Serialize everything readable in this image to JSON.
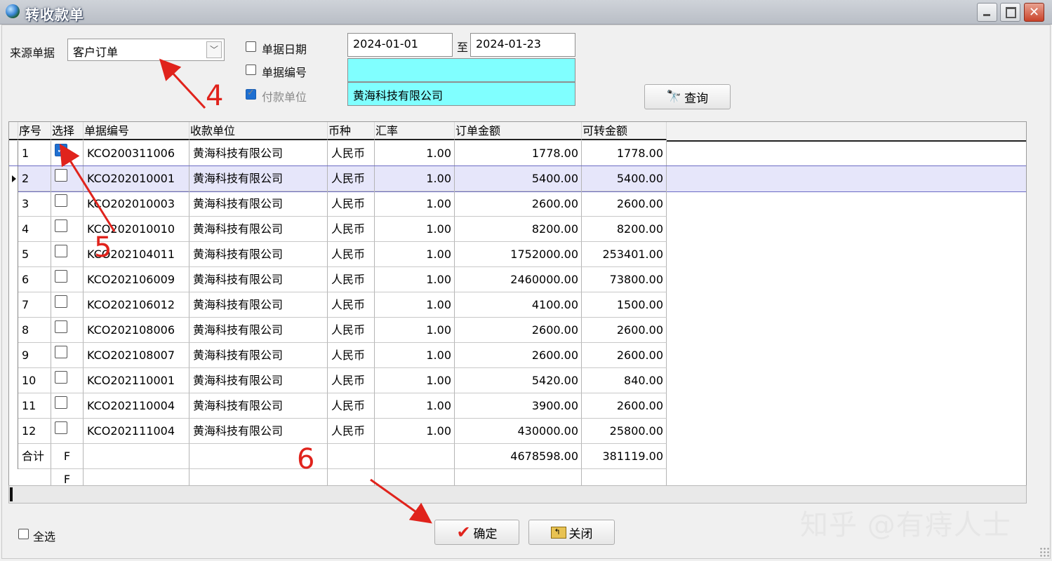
{
  "window": {
    "title": "转收款单"
  },
  "filters": {
    "source_label": "来源单据",
    "source_value": "客户订单",
    "date_label": "单据日期",
    "date_checked": false,
    "date_from": "2024-01-01",
    "date_to_label": "至",
    "date_to": "2024-01-23",
    "number_label": "单据编号",
    "number_checked": false,
    "number_value": "",
    "payer_label": "付款单位",
    "payer_checked": true,
    "payer_value": "黄海科技有限公司",
    "query_button": "查询"
  },
  "table": {
    "columns": [
      "序号",
      "选择",
      "单据编号",
      "收款单位",
      "币种",
      "汇率",
      "订单金额",
      "可转金额"
    ],
    "rows": [
      {
        "no": "1",
        "checked": true,
        "doc": "KCO200311006",
        "payee": "黄海科技有限公司",
        "currency": "人民币",
        "rate": "1.00",
        "order_amount": "1778.00",
        "transferable": "1778.00"
      },
      {
        "no": "2",
        "checked": false,
        "doc": "KCO202010001",
        "payee": "黄海科技有限公司",
        "currency": "人民币",
        "rate": "1.00",
        "order_amount": "5400.00",
        "transferable": "5400.00"
      },
      {
        "no": "3",
        "checked": false,
        "doc": "KCO202010003",
        "payee": "黄海科技有限公司",
        "currency": "人民币",
        "rate": "1.00",
        "order_amount": "2600.00",
        "transferable": "2600.00"
      },
      {
        "no": "4",
        "checked": false,
        "doc": "KCO202010010",
        "payee": "黄海科技有限公司",
        "currency": "人民币",
        "rate": "1.00",
        "order_amount": "8200.00",
        "transferable": "8200.00"
      },
      {
        "no": "5",
        "checked": false,
        "doc": "KCO202104011",
        "payee": "黄海科技有限公司",
        "currency": "人民币",
        "rate": "1.00",
        "order_amount": "1752000.00",
        "transferable": "253401.00"
      },
      {
        "no": "6",
        "checked": false,
        "doc": "KCO202106009",
        "payee": "黄海科技有限公司",
        "currency": "人民币",
        "rate": "1.00",
        "order_amount": "2460000.00",
        "transferable": "73800.00"
      },
      {
        "no": "7",
        "checked": false,
        "doc": "KCO202106012",
        "payee": "黄海科技有限公司",
        "currency": "人民币",
        "rate": "1.00",
        "order_amount": "4100.00",
        "transferable": "1500.00"
      },
      {
        "no": "8",
        "checked": false,
        "doc": "KCO202108006",
        "payee": "黄海科技有限公司",
        "currency": "人民币",
        "rate": "1.00",
        "order_amount": "2600.00",
        "transferable": "2600.00"
      },
      {
        "no": "9",
        "checked": false,
        "doc": "KCO202108007",
        "payee": "黄海科技有限公司",
        "currency": "人民币",
        "rate": "1.00",
        "order_amount": "2600.00",
        "transferable": "2600.00"
      },
      {
        "no": "10",
        "checked": false,
        "doc": "KCO202110001",
        "payee": "黄海科技有限公司",
        "currency": "人民币",
        "rate": "1.00",
        "order_amount": "5420.00",
        "transferable": "840.00"
      },
      {
        "no": "11",
        "checked": false,
        "doc": "KCO202110004",
        "payee": "黄海科技有限公司",
        "currency": "人民币",
        "rate": "1.00",
        "order_amount": "3900.00",
        "transferable": "2600.00"
      },
      {
        "no": "12",
        "checked": false,
        "doc": "KCO202111004",
        "payee": "黄海科技有限公司",
        "currency": "人民币",
        "rate": "1.00",
        "order_amount": "430000.00",
        "transferable": "25800.00"
      }
    ],
    "selected_row": 1,
    "total": {
      "label": "合计",
      "select": "F",
      "order_amount": "4678598.00",
      "transferable": "381119.00"
    },
    "extra_row": {
      "select": "F"
    }
  },
  "footer": {
    "select_all_label": "全选",
    "confirm_button": "确定",
    "close_button": "关闭"
  },
  "annotations": [
    "4",
    "5",
    "6"
  ],
  "watermark": "知乎 @有痔人士"
}
